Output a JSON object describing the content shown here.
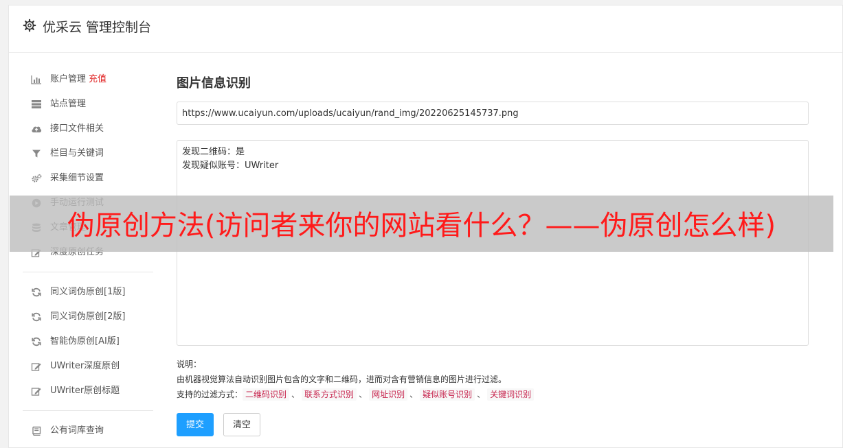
{
  "header": {
    "title": "优采云 管理控制台"
  },
  "sidebar": {
    "groups": [
      [
        {
          "label": "账户管理",
          "extra": "充值",
          "icon": "bar-chart-icon",
          "name": "accounts"
        },
        {
          "label": "站点管理",
          "icon": "server-icon",
          "name": "sites"
        },
        {
          "label": "接口文件相关",
          "icon": "cloud-upload-icon",
          "name": "api-files"
        },
        {
          "label": "栏目与关键词",
          "icon": "filter-icon",
          "name": "columns-keywords"
        },
        {
          "label": "采集细节设置",
          "icon": "gears-icon",
          "name": "collect-settings"
        },
        {
          "label": "手动运行测试",
          "icon": "play-icon",
          "name": "manual-test"
        },
        {
          "label": "文章管理",
          "icon": "database-icon",
          "name": "articles"
        },
        {
          "label": "深度原创任务",
          "icon": "edit-icon",
          "name": "deep-original"
        }
      ],
      [
        {
          "label": "同义词伪原创[1版]",
          "icon": "refresh-icon",
          "name": "synonym-v1"
        },
        {
          "label": "同义词伪原创[2版]",
          "icon": "refresh-icon",
          "name": "synonym-v2"
        },
        {
          "label": "智能伪原创[AI版]",
          "icon": "refresh-icon",
          "name": "ai-rewrite"
        },
        {
          "label": "UWriter深度原创",
          "icon": "edit-icon",
          "name": "uwriter-deep"
        },
        {
          "label": "UWriter原创标题",
          "icon": "edit-icon",
          "name": "uwriter-title"
        }
      ],
      [
        {
          "label": "公有词库查询",
          "icon": "book-icon",
          "name": "public-dict"
        }
      ]
    ]
  },
  "main": {
    "title": "图片信息识别",
    "url_value": "https://www.ucaiyun.com/uploads/ucaiyun/rand_img/20220625145737.png",
    "result_lines": [
      "发现二维码：是",
      "发现疑似账号：UWriter"
    ],
    "notes_title": "说明：",
    "notes_desc": "由机器视觉算法自动识别图片包含的文字和二维码，进而对含有营销信息的图片进行过滤。",
    "filters_label": "支持的过滤方式：",
    "filters": [
      "二维码识别",
      "联系方式识别",
      "网址识别",
      "疑似账号识别",
      "关键词识别"
    ],
    "filter_sep": "、",
    "submit_label": "提交",
    "clear_label": "清空"
  },
  "banner": {
    "text": "伪原创方法(访问者来你的网站看什么？——伪原创怎么样)"
  },
  "colors": {
    "primary": "#1e9fff",
    "recharge": "#e02020",
    "tag_text": "#c7254e",
    "banner_text": "#ff1a1a"
  }
}
